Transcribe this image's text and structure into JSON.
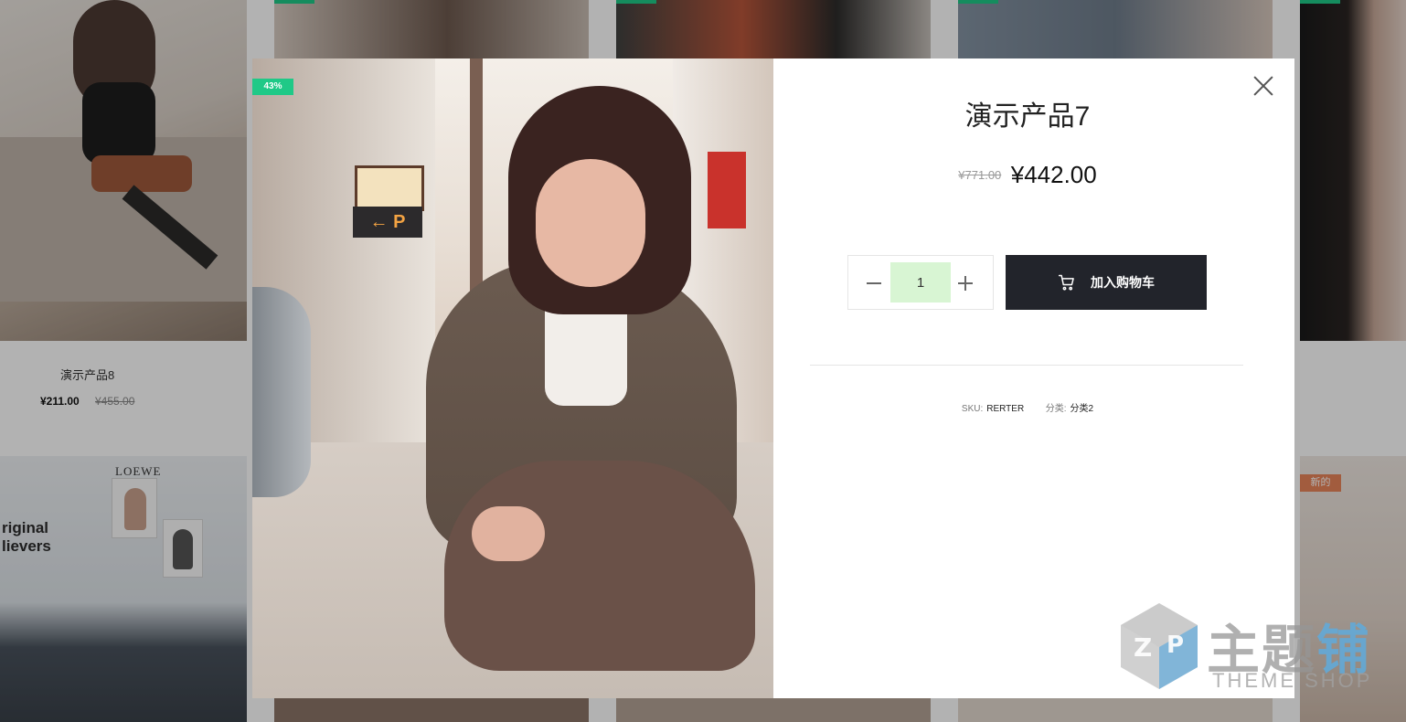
{
  "background_grid": {
    "product8": {
      "name": "演示产品8",
      "price": "¥211.00",
      "old_price": "¥455.00"
    },
    "new_badge": "新的",
    "poster_brand": "LOEWE",
    "bag_text": "riginal\nlievers"
  },
  "modal": {
    "discount_badge": "43%",
    "title": "演示产品7",
    "old_price": "¥771.00",
    "price": "¥442.00",
    "quantity": "1",
    "add_to_cart_label": "加入购物车",
    "sku_label": "SKU:",
    "sku_value": "RERTER",
    "category_label": "分类:",
    "category_value": "分类2",
    "icons": {
      "close": "close-icon",
      "minus": "minus-icon",
      "plus": "plus-icon",
      "cart": "cart-icon"
    }
  },
  "watermark": {
    "cn_text": "主题",
    "cn_text_blue": "铺",
    "en_text": "THEME SHOP"
  },
  "colors": {
    "accent_green": "#1fc987",
    "button_dark": "#22242b",
    "new_badge": "#e8845a",
    "qty_field": "#d8f5d3"
  }
}
